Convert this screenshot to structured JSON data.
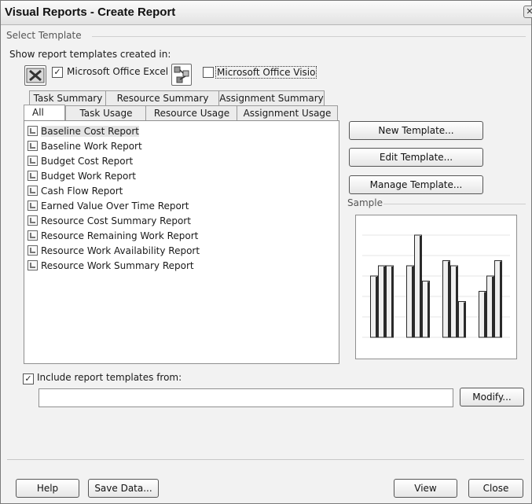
{
  "window": {
    "title": "Visual Reports - Create Report",
    "close_glyph": "✕"
  },
  "select_template": {
    "group_label": "Select Template",
    "show_label": "Show report templates created in:",
    "excel": {
      "checked": true,
      "label": "Microsoft Office Excel",
      "icon": "excel-icon"
    },
    "visio": {
      "checked": false,
      "label": "Microsoft Office Visio",
      "icon": "visio-icon"
    }
  },
  "tabs_back": [
    "Task Summary",
    "Resource Summary",
    "Assignment Summary"
  ],
  "tabs_front": [
    "All",
    "Task Usage",
    "Resource Usage",
    "Assignment Usage"
  ],
  "active_tab": "All",
  "reports": [
    "Baseline Cost Report",
    "Baseline Work Report",
    "Budget Cost Report",
    "Budget Work Report",
    "Cash Flow Report",
    "Earned Value Over Time Report",
    "Resource Cost Summary Report",
    "Resource Remaining Work Report",
    "Resource Work Availability Report",
    "Resource Work Summary Report"
  ],
  "selected_report": "Baseline Cost Report",
  "buttons": {
    "new_template": "New Template...",
    "edit_template": "Edit Template...",
    "manage_template": "Manage Template...",
    "modify": "Modify...",
    "help": "Help",
    "save_data": "Save Data...",
    "view": "View",
    "close": "Close"
  },
  "sample": {
    "label": "Sample",
    "chart_data": {
      "type": "bar",
      "note": "unlabeled thumbnail preview",
      "series": [
        {
          "values": [
            60,
            70,
            75,
            45
          ]
        },
        {
          "values": [
            70,
            100,
            70,
            60
          ]
        },
        {
          "values": [
            70,
            55,
            35,
            75
          ]
        }
      ],
      "colors": {
        "bar": "#f0f0f0",
        "edge": "#2a2a2a",
        "grid": "#e6e6e6"
      }
    }
  },
  "include": {
    "checked": true,
    "label": "Include report templates from:",
    "path_value": ""
  }
}
